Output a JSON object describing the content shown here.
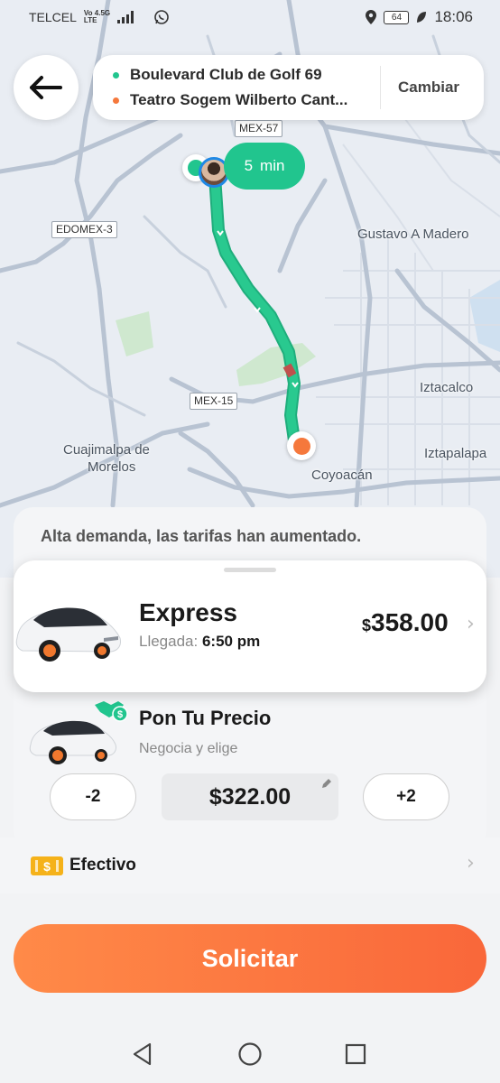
{
  "status_bar": {
    "carrier": "TELCEL",
    "network_top": "Vo 4.5G",
    "network_bottom": "LTE",
    "battery": "64",
    "time": "18:06",
    "icons": [
      "signal-icon",
      "whatsapp-icon",
      "location-icon",
      "battery-icon",
      "leaf-icon"
    ]
  },
  "header": {
    "back_icon": "arrow-left-icon",
    "pickup": "Boulevard Club de Golf 69",
    "dropoff": "Teatro Sogem Wilberto Cant...",
    "change_label": "Cambiar",
    "pickup_color": "#21c58e",
    "dropoff_color": "#f5783c"
  },
  "map": {
    "eta_value": "5",
    "eta_unit": "min",
    "labels": {
      "gustavo": "Gustavo A Madero",
      "iztacalco": "Iztacalco",
      "cuajimalpa_1": "Cuajimalpa de",
      "cuajimalpa_2": "Morelos",
      "coyoacan": "Coyoacán",
      "iztapalapa": "Iztapalapa"
    },
    "shields": {
      "mex57": "MEX-57",
      "edomex3": "EDOMEX-3",
      "mex15": "MEX-15"
    },
    "route_color": "#21c58e"
  },
  "sheet": {
    "demand_notice": "Alta demanda, las tarifas han aumentado.",
    "express": {
      "title": "Express",
      "arrival_label": "Llegada:",
      "arrival_time": "6:50 pm",
      "currency": "$",
      "price": "358.00"
    },
    "pon_tu_precio": {
      "title": "Pon Tu Precio",
      "subtitle": "Negocia y elige",
      "minus": "-2",
      "fare": "$322.00",
      "plus": "+2"
    }
  },
  "payment": {
    "icon_symbol": "$",
    "label": "Efectivo"
  },
  "request_label": "Solicitar",
  "nav": [
    "back-triangle-icon",
    "home-circle-icon",
    "recents-square-icon"
  ]
}
